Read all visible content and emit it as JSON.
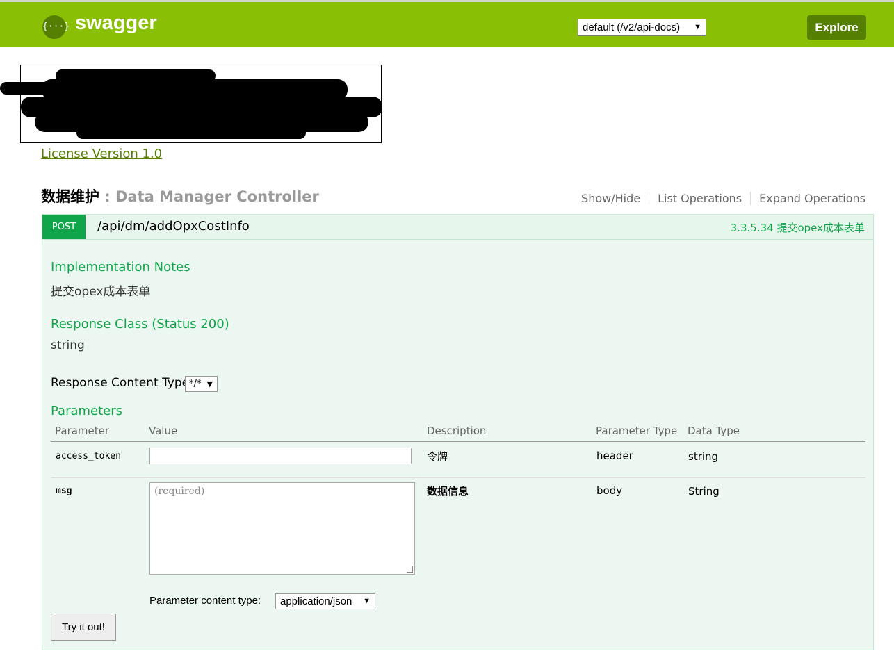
{
  "header": {
    "logo_glyph": "{···}",
    "logo_text": "swagger",
    "api_select": "default (/v2/api-docs)",
    "explore": "Explore",
    "background_color": "#89bf04"
  },
  "info": {
    "license": "License Version 1.0"
  },
  "controller": {
    "title_zh": "数据维护",
    "title_en": " : Data Manager Controller",
    "links": [
      "Show/Hide",
      "List Operations",
      "Expand Operations"
    ]
  },
  "operation": {
    "method": "POST",
    "path": "/api/dm/addOpxCostInfo",
    "summary": "3.3.5.34 提交opex成本表单",
    "impl_notes_heading": "Implementation Notes",
    "impl_notes": "提交opex成本表单",
    "response_class_heading": "Response Class (Status 200)",
    "response_class": "string",
    "response_content_type_label": "Response Content Type",
    "response_content_type": "*/*",
    "parameters_heading": "Parameters",
    "columns": [
      "Parameter",
      "Value",
      "Description",
      "Parameter Type",
      "Data Type"
    ],
    "params": [
      {
        "name": "access_token",
        "value": "",
        "description": "令牌",
        "param_type": "header",
        "data_type": "string"
      },
      {
        "name": "msg",
        "placeholder": "(required)",
        "description": "数据信息",
        "param_type": "body",
        "data_type": "String"
      }
    ],
    "param_content_type_label": "Parameter content type:",
    "param_content_type": "application/json",
    "try_button": "Try it out!",
    "method_color": "#10a54a"
  }
}
